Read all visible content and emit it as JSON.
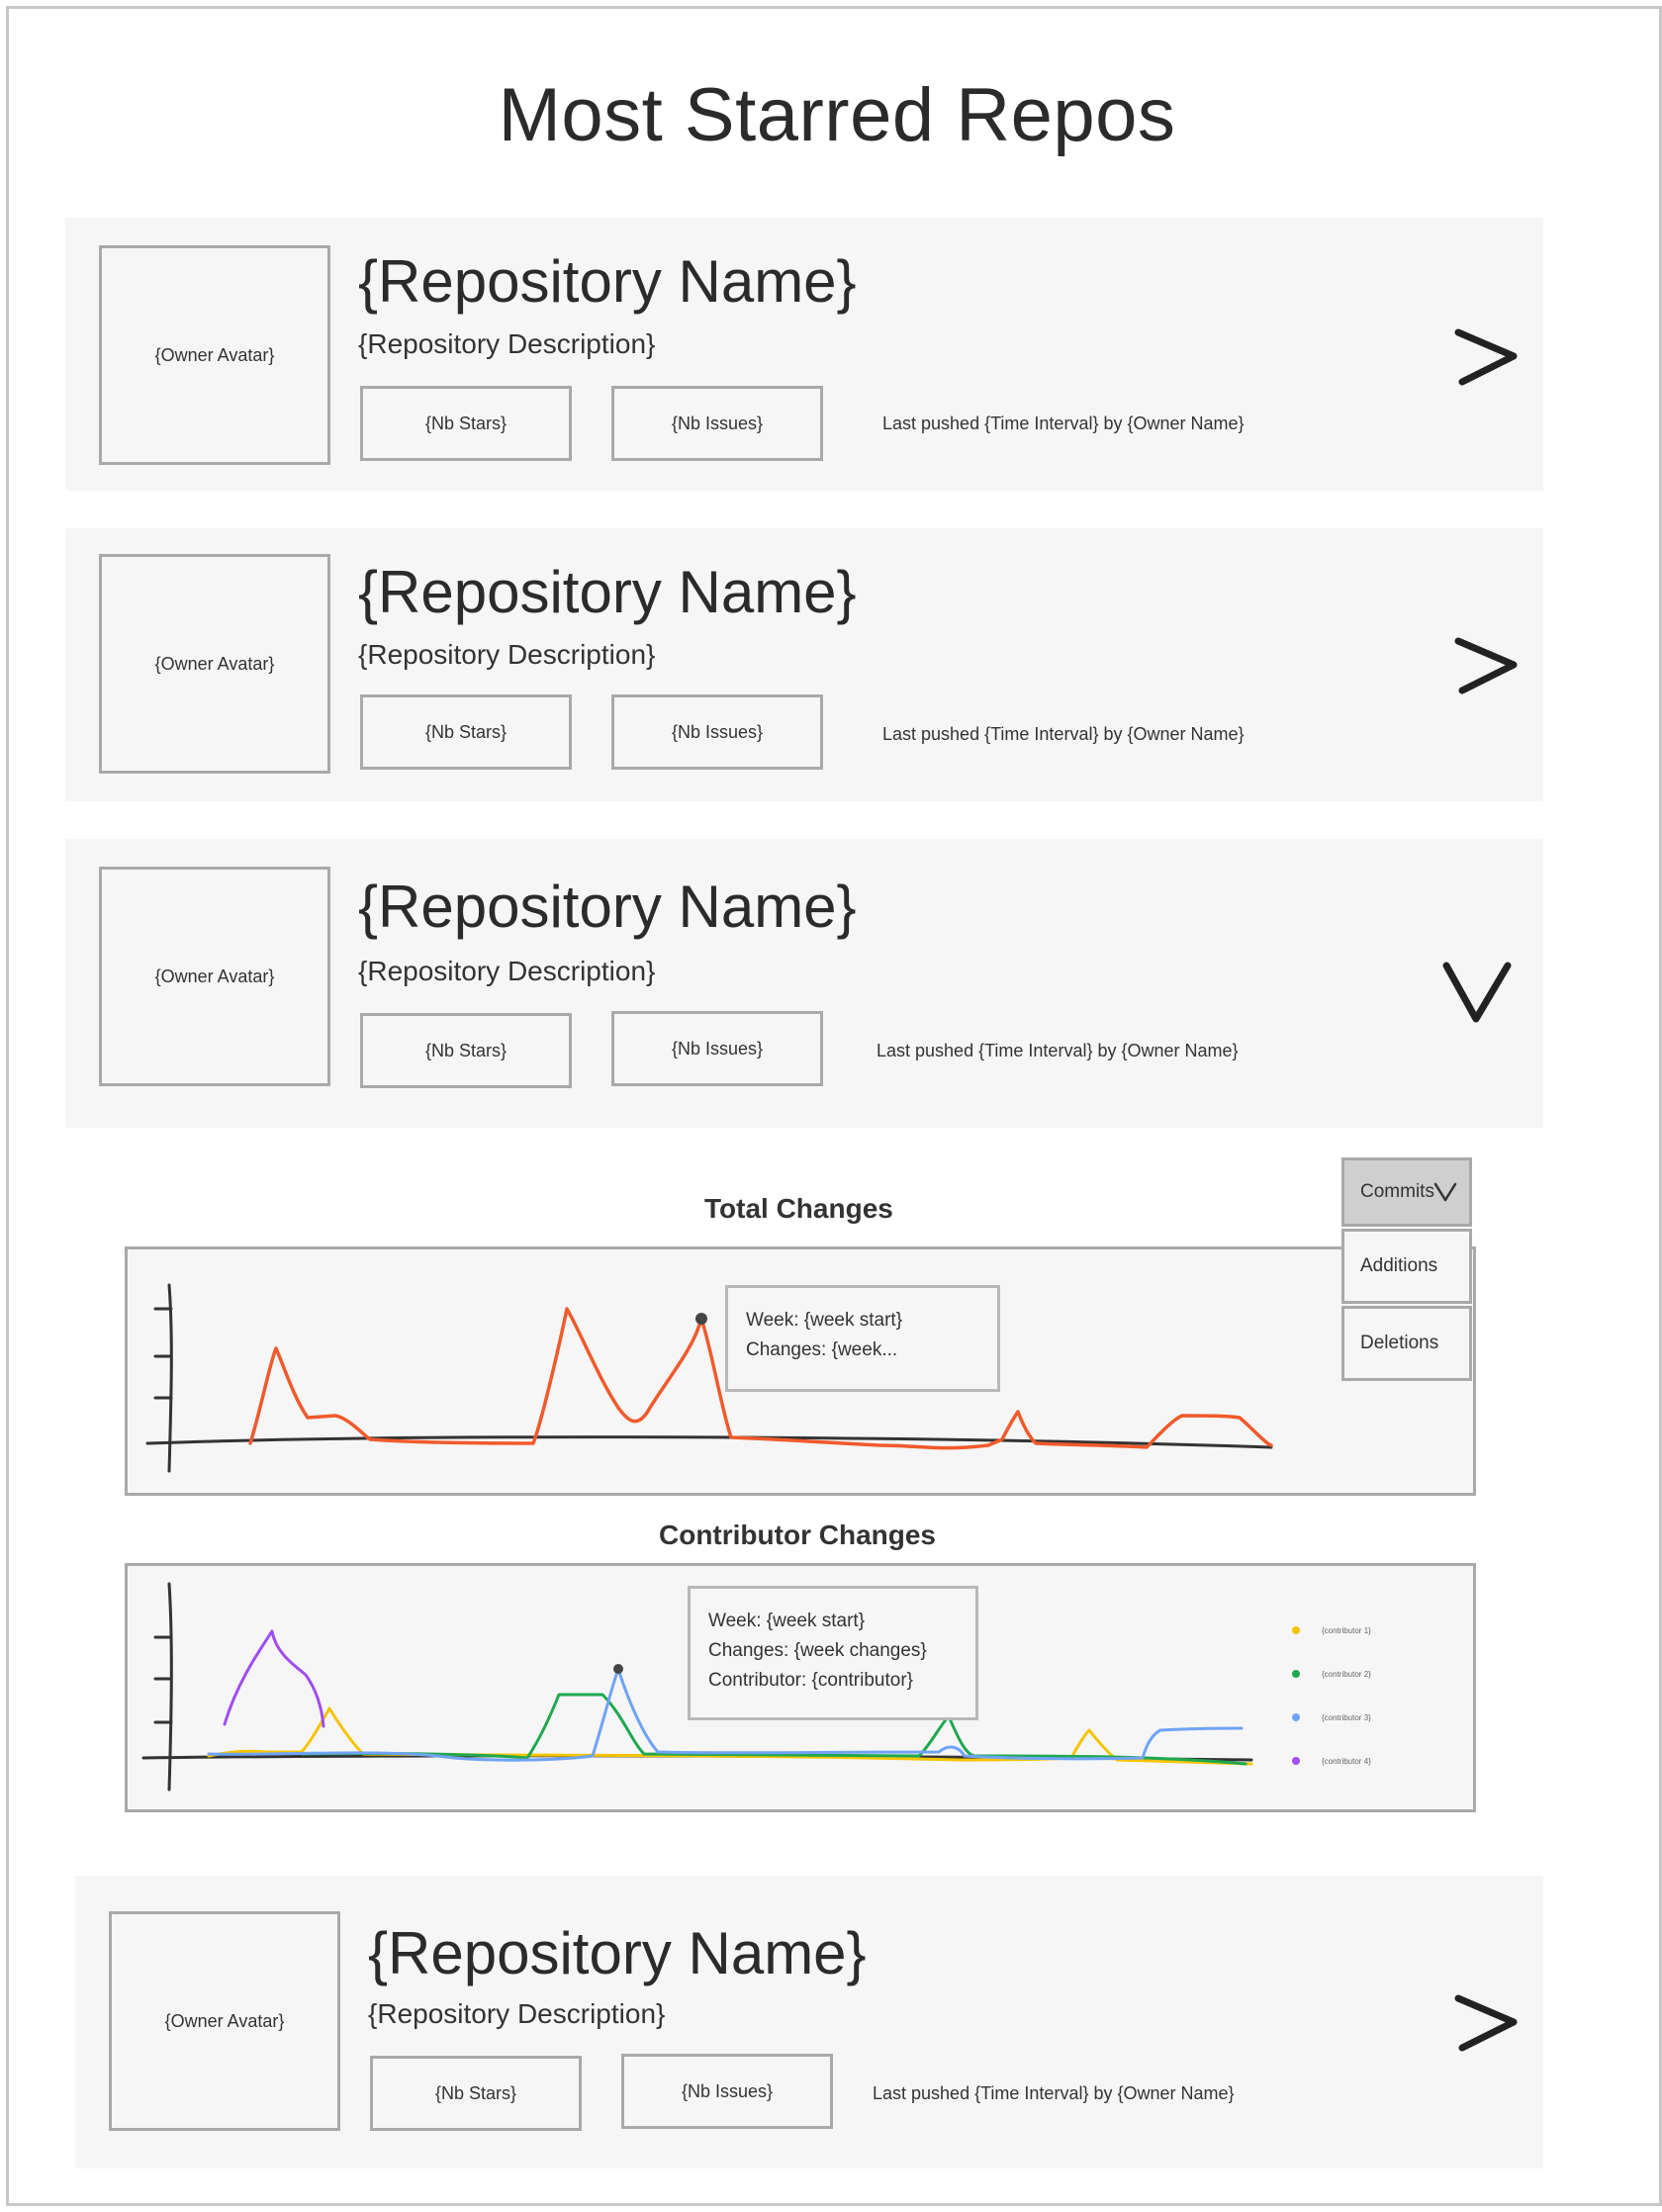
{
  "page": {
    "title": "Most Starred Repos"
  },
  "repos": [
    {
      "avatar": "{Owner Avatar}",
      "name": "{Repository Name}",
      "description": "{Repository Description}",
      "stars": "{Nb Stars}",
      "issues": "{Nb Issues}",
      "pushed": "Last pushed {Time Interval} by {Owner Name}",
      "toggle_icon": "chevron-right-icon"
    },
    {
      "avatar": "{Owner Avatar}",
      "name": "{Repository Name}",
      "description": "{Repository Description}",
      "stars": "{Nb Stars}",
      "issues": "{Nb Issues}",
      "pushed": "Last pushed {Time Interval} by {Owner Name}",
      "toggle_icon": "chevron-right-icon"
    },
    {
      "avatar": "{Owner Avatar}",
      "name": "{Repository Name}",
      "description": "{Repository Description}",
      "stars": "{Nb Stars}",
      "issues": "{Nb Issues}",
      "pushed": "Last pushed {Time Interval} by {Owner Name}",
      "toggle_icon": "chevron-down-icon"
    },
    {
      "avatar": "{Owner Avatar}",
      "name": "{Repository Name}",
      "description": "{Repository Description}",
      "stars": "{Nb Stars}",
      "issues": "{Nb Issues}",
      "pushed": "Last pushed {Time Interval} by {Owner Name}",
      "toggle_icon": "chevron-right-icon"
    }
  ],
  "details": {
    "metric_dropdown": {
      "selected": "Commits",
      "options": [
        "Additions",
        "Deletions"
      ],
      "icon": "chevron-down-icon"
    },
    "total_chart": {
      "title": "Total Changes",
      "tooltip": {
        "line1": "Week: {week start}",
        "line2": "Changes: {week..."
      },
      "color": "#f05a2c"
    },
    "contributor_chart": {
      "title": "Contributor Changes",
      "tooltip": {
        "line1": "Week: {week start}",
        "line2": "Changes: {week changes}",
        "line3": "Contributor: {contributor}"
      },
      "legend": [
        {
          "label": "{contributor 1}",
          "color": "#f5c400"
        },
        {
          "label": "{contributor 2}",
          "color": "#1fa84f"
        },
        {
          "label": "{contributor 3}",
          "color": "#6fa3f5"
        },
        {
          "label": "{contributor 4}",
          "color": "#a14df0"
        }
      ]
    }
  }
}
